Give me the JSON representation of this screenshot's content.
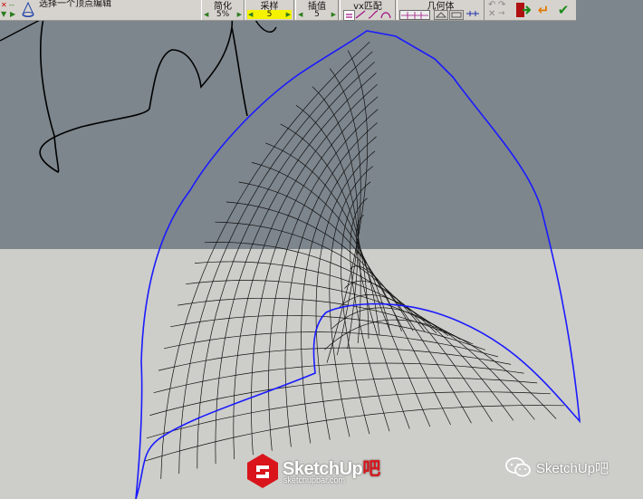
{
  "toolbar": {
    "mode_label": "选择一个顶点编辑",
    "groups": [
      {
        "title": "简化",
        "value": "5%"
      },
      {
        "title": "采样",
        "value": "5"
      },
      {
        "title": "插值",
        "value": "5"
      },
      {
        "title": "vx匹配",
        "value": ""
      },
      {
        "title": "几何体",
        "value": ""
      }
    ]
  },
  "watermark": {
    "brand_main": "SketchUp",
    "brand_accent": "吧",
    "url": "sketchupbar.com"
  },
  "wechat": {
    "account": "SketchUp吧"
  },
  "colors": {
    "sky": "#7d868d",
    "ground": "#cdcdc9",
    "surface_edge": "#1a1aff",
    "mesh": "#111111",
    "brand_red": "#d9141b"
  }
}
